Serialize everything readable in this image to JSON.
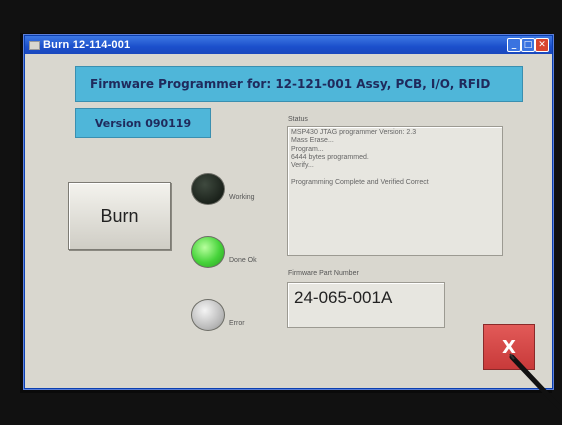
{
  "window": {
    "title": "Burn 12-114-001",
    "minimize_glyph": "_",
    "maximize_glyph": "□",
    "close_glyph": "✕"
  },
  "banner": {
    "text": "Firmware Programmer for:  12-121-001 Assy, PCB, I/O, RFID"
  },
  "version": {
    "text": "Version 090119"
  },
  "burn_button": {
    "label": "Burn"
  },
  "indicators": [
    {
      "label": "Working",
      "state": "off",
      "color": "#1b221b"
    },
    {
      "label": "Done Ok",
      "state": "on",
      "color": "#46d33a"
    },
    {
      "label": "Error",
      "state": "off",
      "color": "#b9b9b9"
    }
  ],
  "status": {
    "label": "Status",
    "lines": [
      "MSP430 JTAG programmer Version: 2.3",
      "Mass Erase...",
      "Program...",
      "6444 bytes programmed.",
      "Verify...",
      "",
      "Programming Complete and Verified Correct"
    ]
  },
  "firmware_part": {
    "label": "Firmware Part Number",
    "value": "24-065-001A"
  },
  "exit_button": {
    "glyph": "X",
    "color": "#c83a3a"
  },
  "colors": {
    "accent": "#4fb6d9",
    "titlebar": "#1b4fcb"
  }
}
